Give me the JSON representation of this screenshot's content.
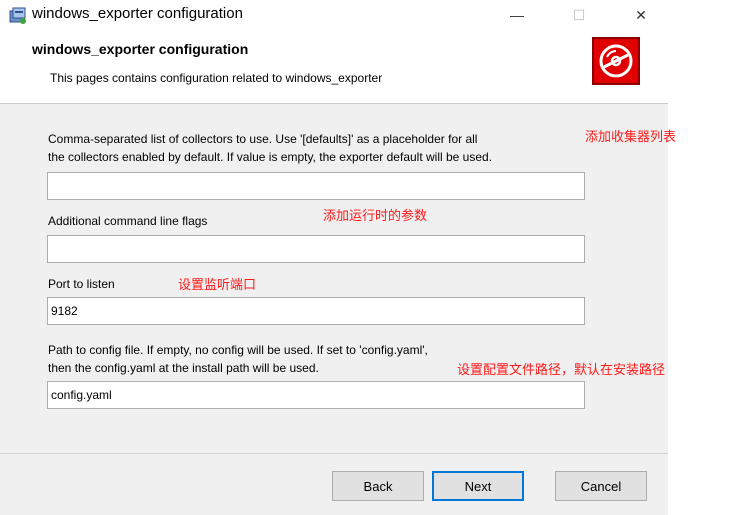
{
  "window": {
    "title": "windows_exporter configuration",
    "minimize_glyph": "—",
    "maximize_glyph": "☐",
    "close_glyph": "✕"
  },
  "banner": {
    "title": "windows_exporter configuration",
    "subtitle": "This pages contains configuration related to windows_exporter",
    "logo_icon": "disc-icon",
    "logo_color": "#e00000"
  },
  "form": {
    "collectors": {
      "label_line1": "Comma-separated list of collectors to use. Use '[defaults]' as a placeholder for all",
      "label_line2": "the collectors enabled by default. If value is empty, the exporter default will be used.",
      "value": ""
    },
    "extra_flags": {
      "label": "Additional command line flags",
      "value": ""
    },
    "port": {
      "label": "Port to listen",
      "value": "9182"
    },
    "config_path": {
      "label_line1": "Path to config file. If empty, no config will be used. If set to 'config.yaml',",
      "label_line2": "then the config.yaml at the install path will be used.",
      "value": "config.yaml"
    }
  },
  "annotations": {
    "collectors": "添加收集器列表",
    "extra_flags": "添加运行时的参数",
    "port": "设置监听端口",
    "config_path": "设置配置文件路径，默认在安装路径",
    "color": "#ff1a1a"
  },
  "buttons": {
    "back": "Back",
    "next": "Next",
    "cancel": "Cancel"
  }
}
